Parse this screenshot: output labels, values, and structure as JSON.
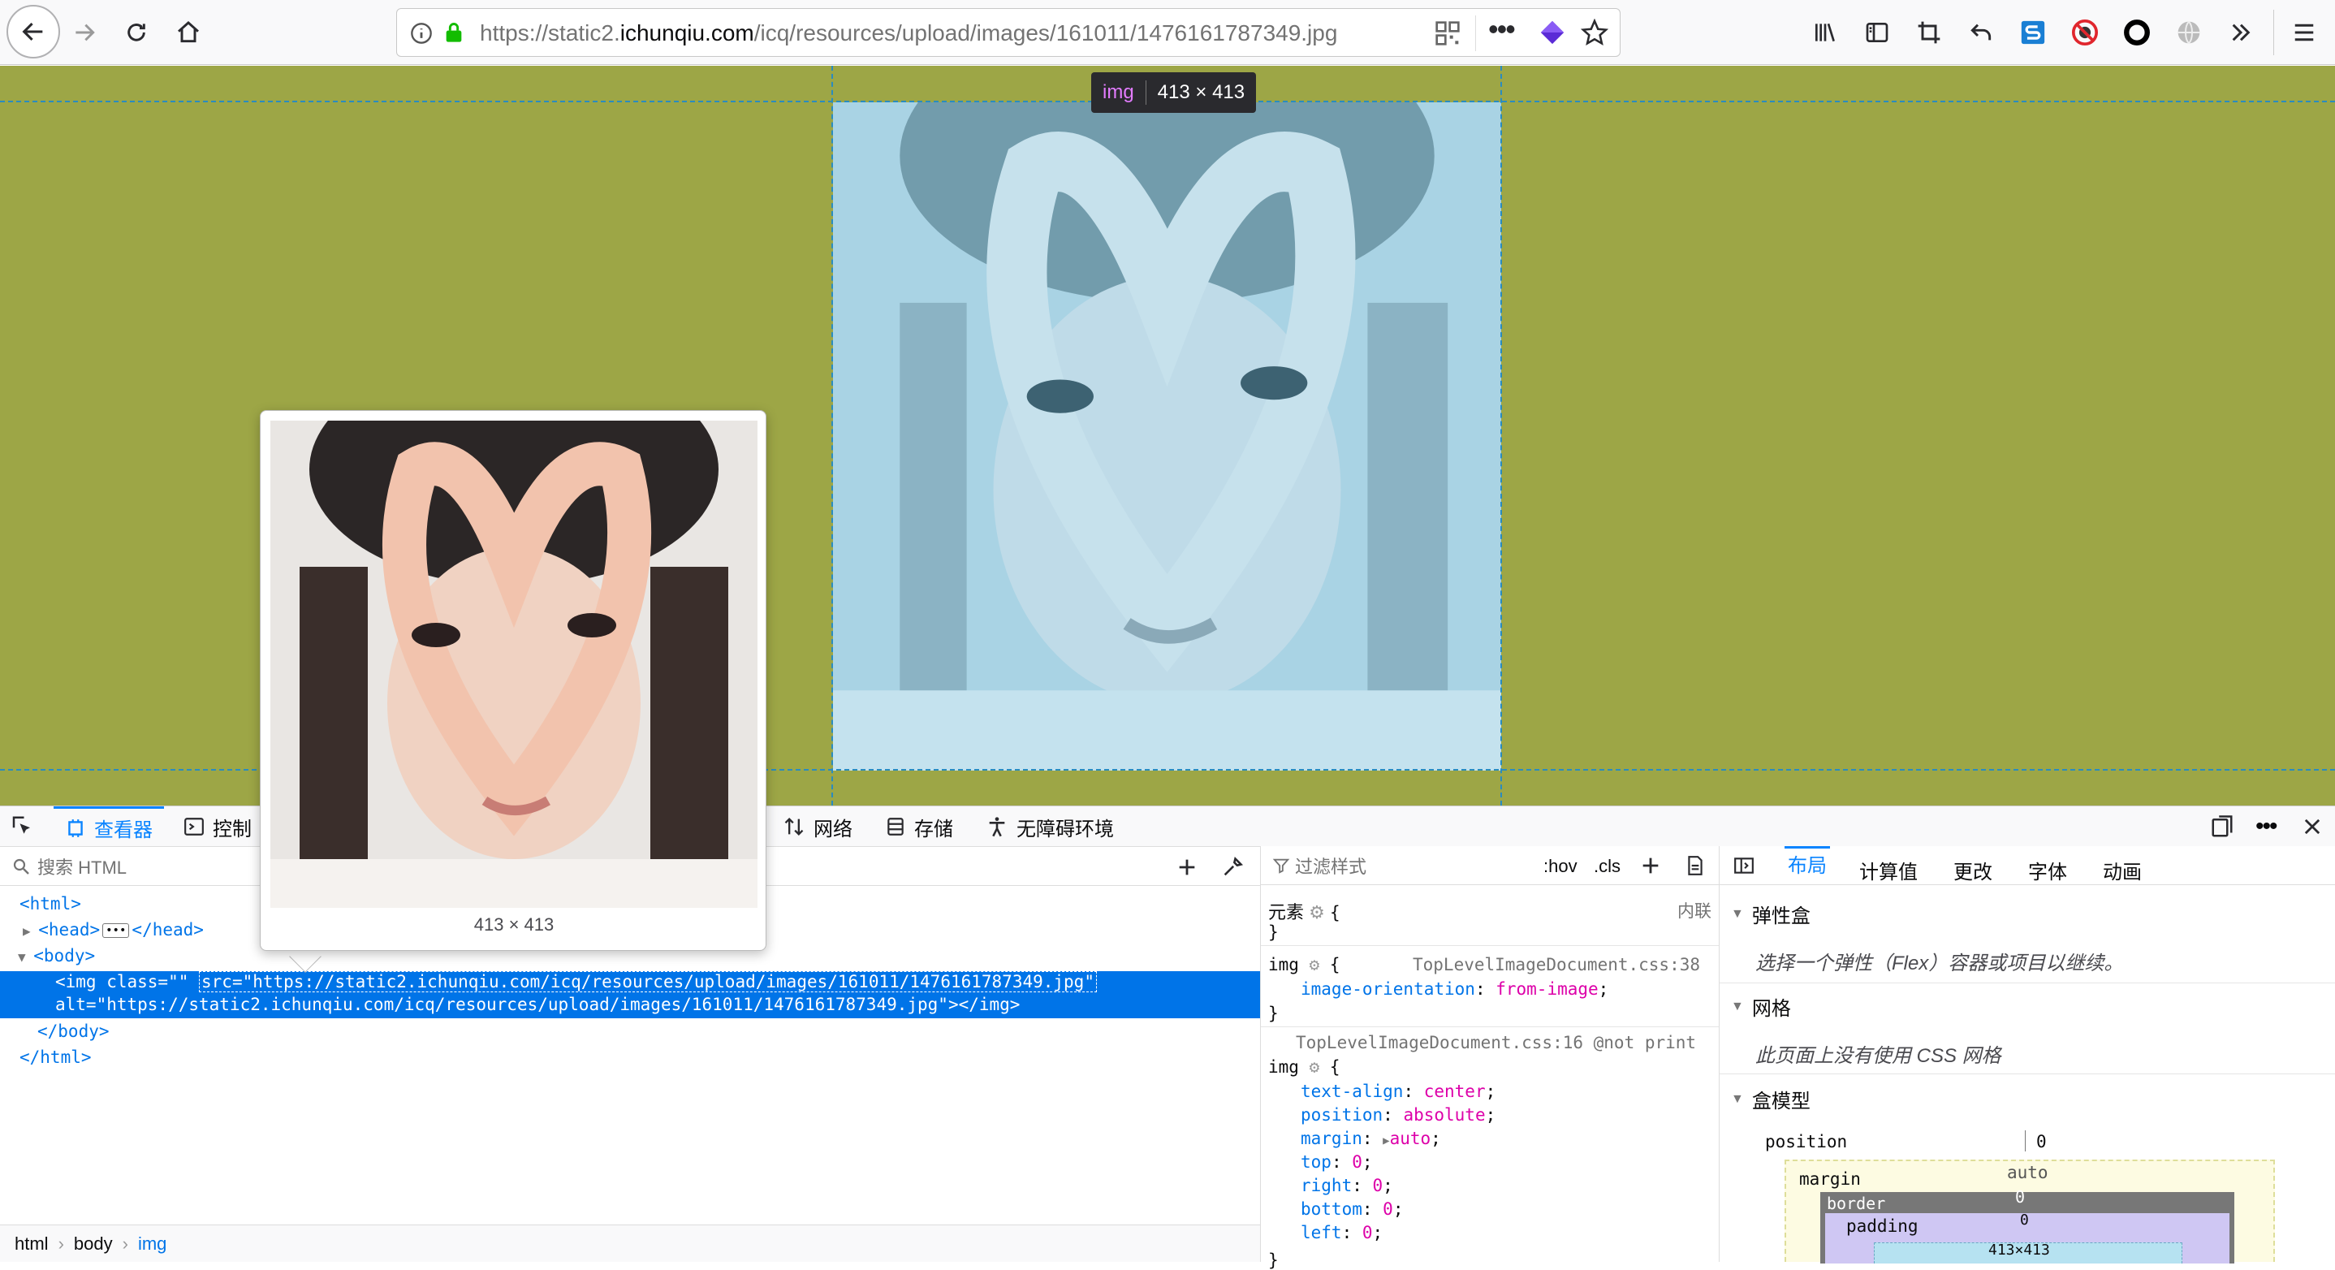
{
  "browser": {
    "url_prefix": "https://static2.",
    "url_domain": "ichunqiu.com",
    "url_path": "/icq/resources/upload/images/161011/1476161787349.jpg"
  },
  "page": {
    "infobar_tag": "img",
    "infobar_size": "413 × 413",
    "bg_color": "#9da646"
  },
  "devtools": {
    "tabs": {
      "inspector": "查看器",
      "console": "控制",
      "network": "网络",
      "storage": "存储",
      "accessibility": "无障碍环境"
    },
    "search_placeholder": "搜索 HTML",
    "filter_placeholder": "过滤样式",
    "hov": ":hov",
    "cls": ".cls",
    "tooltip_size": "413 × 413",
    "markup": {
      "html_open": "<html>",
      "head": "<head>",
      "head_close": "</head>",
      "body_open": "<body>",
      "img_line1_a": "<img class=\"\" ",
      "img_line1_b": "src=\"https://static2.ichunqiu.com/icq/resources/upload/images/161011/1476161787349.jpg\"",
      "img_line2": "alt=\"https://static2.ichunqiu.com/icq/resources/upload/images/161011/1476161787349.jpg\"></img>",
      "body_close": "</body>",
      "html_close": "</html>"
    },
    "breadcrumb": [
      "html",
      "body",
      "img"
    ],
    "rules": {
      "element_label": "元素",
      "inline_label": "内联",
      "rule1_selector": "img",
      "rule1_source": "TopLevelImageDocument.css:38",
      "rule1_prop": "image-orientation",
      "rule1_val": "from-image",
      "rule2_source": "TopLevelImageDocument.css:16 @not print",
      "rule2_selector": "img",
      "rule2_decls": [
        {
          "p": "text-align",
          "v": "center"
        },
        {
          "p": "position",
          "v": "absolute"
        },
        {
          "p": "margin",
          "v": "auto"
        },
        {
          "p": "top",
          "v": "0"
        },
        {
          "p": "right",
          "v": "0"
        },
        {
          "p": "bottom",
          "v": "0"
        },
        {
          "p": "left",
          "v": "0"
        }
      ]
    },
    "layout_tabs": [
      "布局",
      "计算值",
      "更改",
      "字体",
      "动画"
    ],
    "layout": {
      "flex_title": "弹性盒",
      "flex_msg": "选择一个弹性（Flex）容器或项目以继续。",
      "grid_title": "网格",
      "grid_msg": "此页面上没有使用 CSS 网格",
      "box_title": "盒模型",
      "position_label": "position",
      "position_val": "0",
      "margin_label": "margin",
      "margin_top": "auto",
      "border_label": "border",
      "border_val": "0",
      "padding_label": "padding",
      "padding_val": "0",
      "content_size": "413×413"
    }
  }
}
